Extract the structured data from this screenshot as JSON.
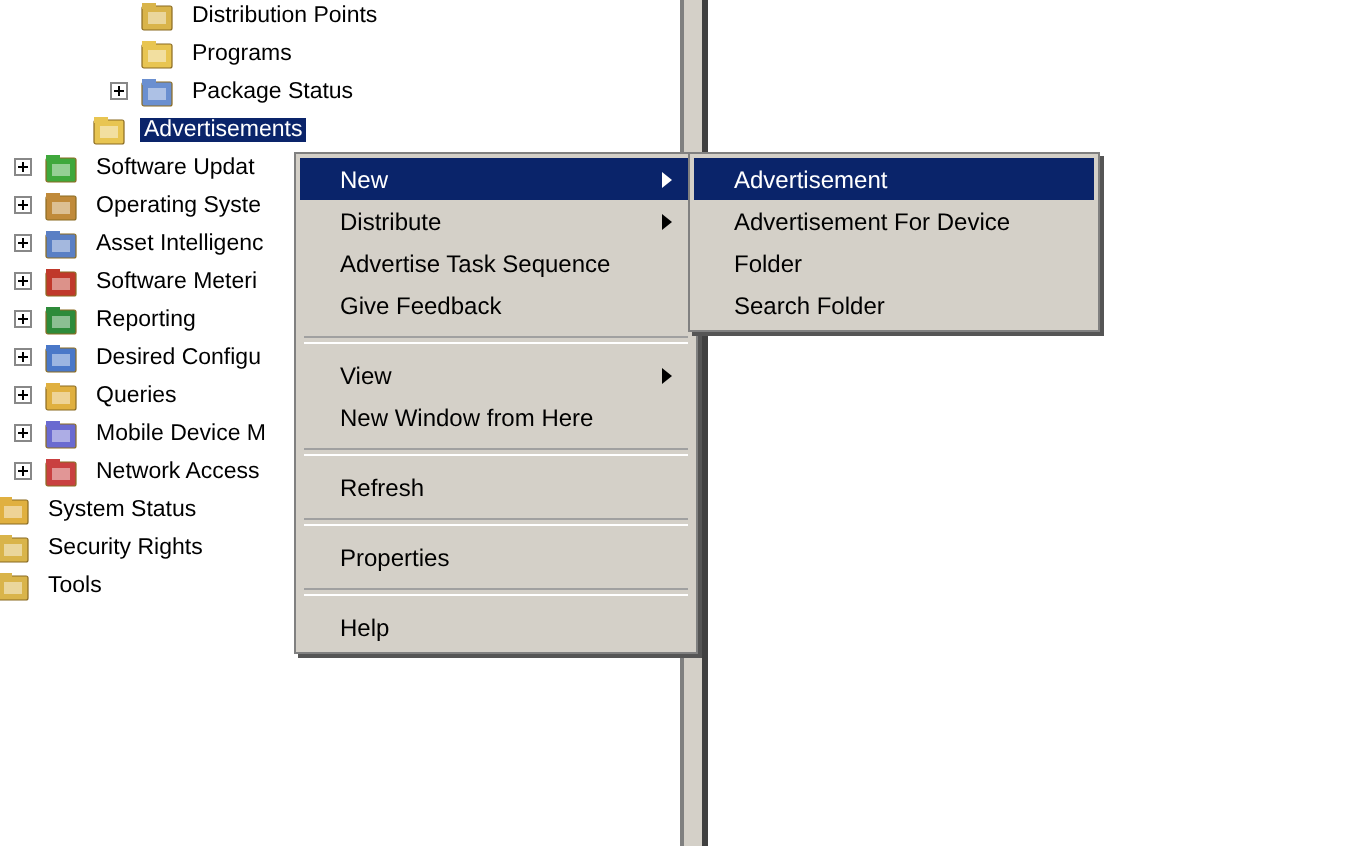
{
  "tree": {
    "items": [
      {
        "children": [
          {
            "children": [
              {
                "children": [
                  {
                    "label": "Distribution Points",
                    "selected": false
                  },
                  {
                    "label": "Programs",
                    "selected": false
                  },
                  {
                    "label": "Package Status",
                    "selected": false,
                    "expanded": false
                  }
                ]
              },
              {
                "label": "Advertisements",
                "selected": true
              }
            ]
          },
          {
            "label": "Software Updat",
            "selected": false,
            "expanded": false
          },
          {
            "label": "Operating Syste",
            "selected": false,
            "expanded": false
          },
          {
            "label": "Asset Intelligenc",
            "selected": false,
            "expanded": false
          },
          {
            "label": "Software Meteri",
            "selected": false,
            "expanded": false
          },
          {
            "label": "Reporting",
            "selected": false,
            "expanded": false
          },
          {
            "label": "Desired Configu",
            "selected": false,
            "expanded": false
          },
          {
            "label": "Queries",
            "selected": false,
            "expanded": false
          },
          {
            "label": "Mobile Device M",
            "selected": false,
            "expanded": false
          },
          {
            "label": "Network Access",
            "selected": false,
            "expanded": false
          }
        ]
      },
      {
        "label": "System Status",
        "selected": false
      },
      {
        "label": "Security Rights",
        "selected": false
      },
      {
        "label": "Tools",
        "selected": false
      }
    ]
  },
  "context_menu": {
    "items": [
      {
        "kind": "item",
        "label": "New",
        "submenu": true,
        "selected": true
      },
      {
        "kind": "item",
        "label": "Distribute",
        "submenu": true,
        "selected": false
      },
      {
        "kind": "item",
        "label": "Advertise Task Sequence",
        "submenu": false,
        "selected": false
      },
      {
        "kind": "item",
        "label": "Give Feedback",
        "submenu": false,
        "selected": false
      },
      {
        "kind": "separator"
      },
      {
        "kind": "item",
        "label": "View",
        "submenu": true,
        "selected": false
      },
      {
        "kind": "item",
        "label": "New Window from Here",
        "submenu": false,
        "selected": false
      },
      {
        "kind": "separator"
      },
      {
        "kind": "item",
        "label": "Refresh",
        "submenu": false,
        "selected": false
      },
      {
        "kind": "separator"
      },
      {
        "kind": "item",
        "label": "Properties",
        "submenu": false,
        "selected": false
      },
      {
        "kind": "separator"
      },
      {
        "kind": "item",
        "label": "Help",
        "submenu": false,
        "selected": false
      }
    ]
  },
  "submenu": {
    "items": [
      {
        "label": "Advertisement",
        "selected": true
      },
      {
        "label": "Advertisement For Device",
        "selected": false
      },
      {
        "label": "Folder",
        "selected": false
      },
      {
        "label": "Search Folder",
        "selected": false
      }
    ]
  }
}
